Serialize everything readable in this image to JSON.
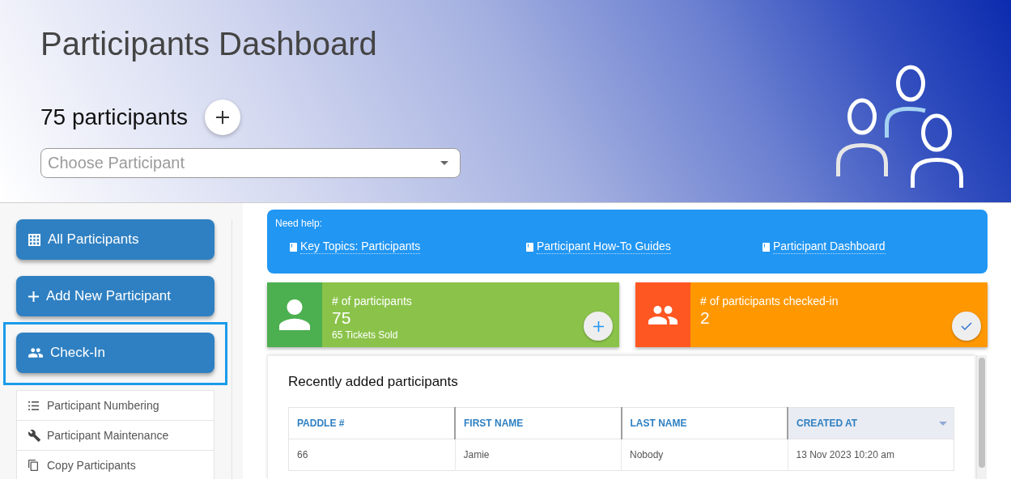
{
  "header": {
    "title": "Participants Dashboard",
    "participant_count": "75 participants"
  },
  "participant_select": {
    "placeholder": "Choose Participant"
  },
  "sidebar": {
    "buttons": [
      {
        "label": "All Participants",
        "highlighted": false
      },
      {
        "label": "Add New Participant",
        "highlighted": false
      },
      {
        "label": "Check-In",
        "highlighted": true
      }
    ],
    "menu": [
      {
        "label": "Participant Numbering"
      },
      {
        "label": "Participant Maintenance"
      },
      {
        "label": "Copy Participants"
      }
    ]
  },
  "help": {
    "title": "Need help:",
    "links": [
      "Key Topics: Participants",
      "Participant How-To Guides",
      "Participant Dashboard"
    ]
  },
  "stats": [
    {
      "kind": "count",
      "label": "# of participants",
      "value": "75",
      "note": "65 Tickets Sold"
    },
    {
      "kind": "checked_in",
      "label": "# of participants checked-in",
      "value": "2"
    }
  ],
  "recent": {
    "title": "Recently added participants",
    "columns": [
      {
        "label": "PADDLE #",
        "sorted": false
      },
      {
        "label": "FIRST NAME",
        "sorted": false
      },
      {
        "label": "LAST NAME",
        "sorted": false
      },
      {
        "label": "CREATED AT",
        "sorted": true
      }
    ],
    "rows": [
      [
        "66",
        "Jamie",
        "Nobody",
        "13 Nov 2023 10:20 am"
      ]
    ]
  }
}
